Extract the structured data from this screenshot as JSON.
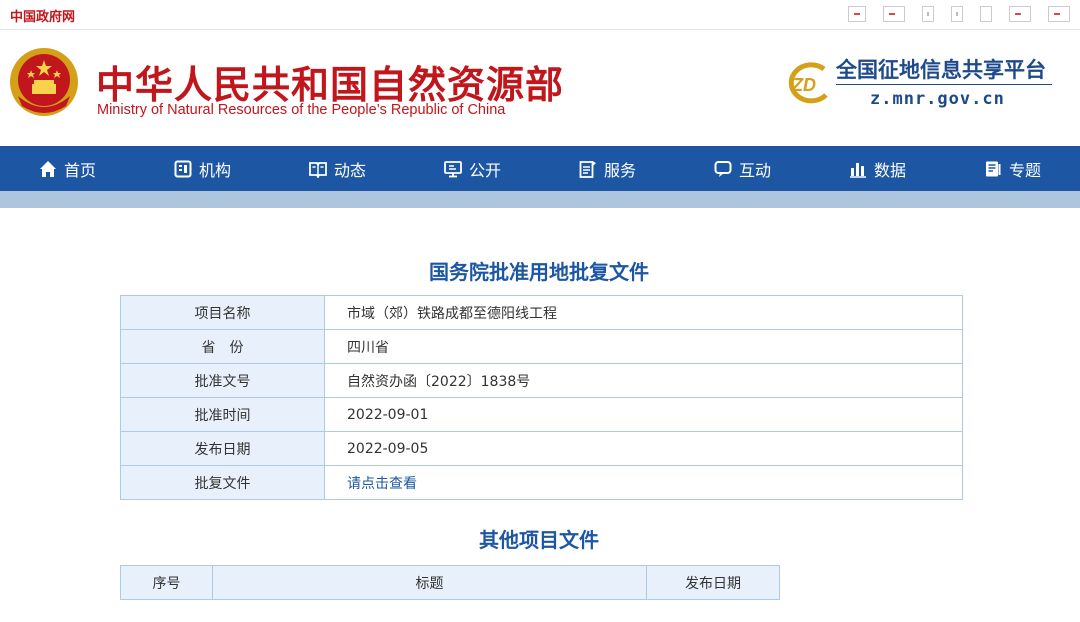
{
  "topbar": {
    "gov_link": "中国政府网"
  },
  "header": {
    "title": "中华人民共和国自然资源部",
    "subtitle": "Ministry of Natural Resources of the People’s Republic of China",
    "platform_title": "全国征地信息共享平台",
    "platform_url": "z.mnr.gov.cn",
    "platform_logo_text": "ZD"
  },
  "nav": [
    {
      "label": "首页",
      "icon": "home-icon"
    },
    {
      "label": "机构",
      "icon": "org-icon"
    },
    {
      "label": "动态",
      "icon": "news-icon"
    },
    {
      "label": "公开",
      "icon": "open-icon"
    },
    {
      "label": "服务",
      "icon": "service-icon"
    },
    {
      "label": "互动",
      "icon": "chat-icon"
    },
    {
      "label": "数据",
      "icon": "chart-icon"
    },
    {
      "label": "专题",
      "icon": "topic-icon"
    }
  ],
  "detail": {
    "heading": "国务院批准用地批复文件",
    "rows": [
      {
        "key": "项目名称",
        "value": "市域（郊）铁路成都至德阳线工程"
      },
      {
        "key": "省　份",
        "value": "四川省"
      },
      {
        "key": "批准文号",
        "value": "自然资办函〔2022〕1838号"
      },
      {
        "key": "批准时间",
        "value": "2022-09-01"
      },
      {
        "key": "发布日期",
        "value": "2022-09-05"
      },
      {
        "key": "批复文件",
        "value": "请点击查看"
      }
    ]
  },
  "other": {
    "heading": "其他项目文件",
    "columns": [
      "序号",
      "标题",
      "发布日期"
    ]
  },
  "colors": {
    "brand_red": "#c0161c",
    "nav_blue": "#1d57a3",
    "cell_bg": "#e8f1fb",
    "border": "#aec9e6"
  }
}
